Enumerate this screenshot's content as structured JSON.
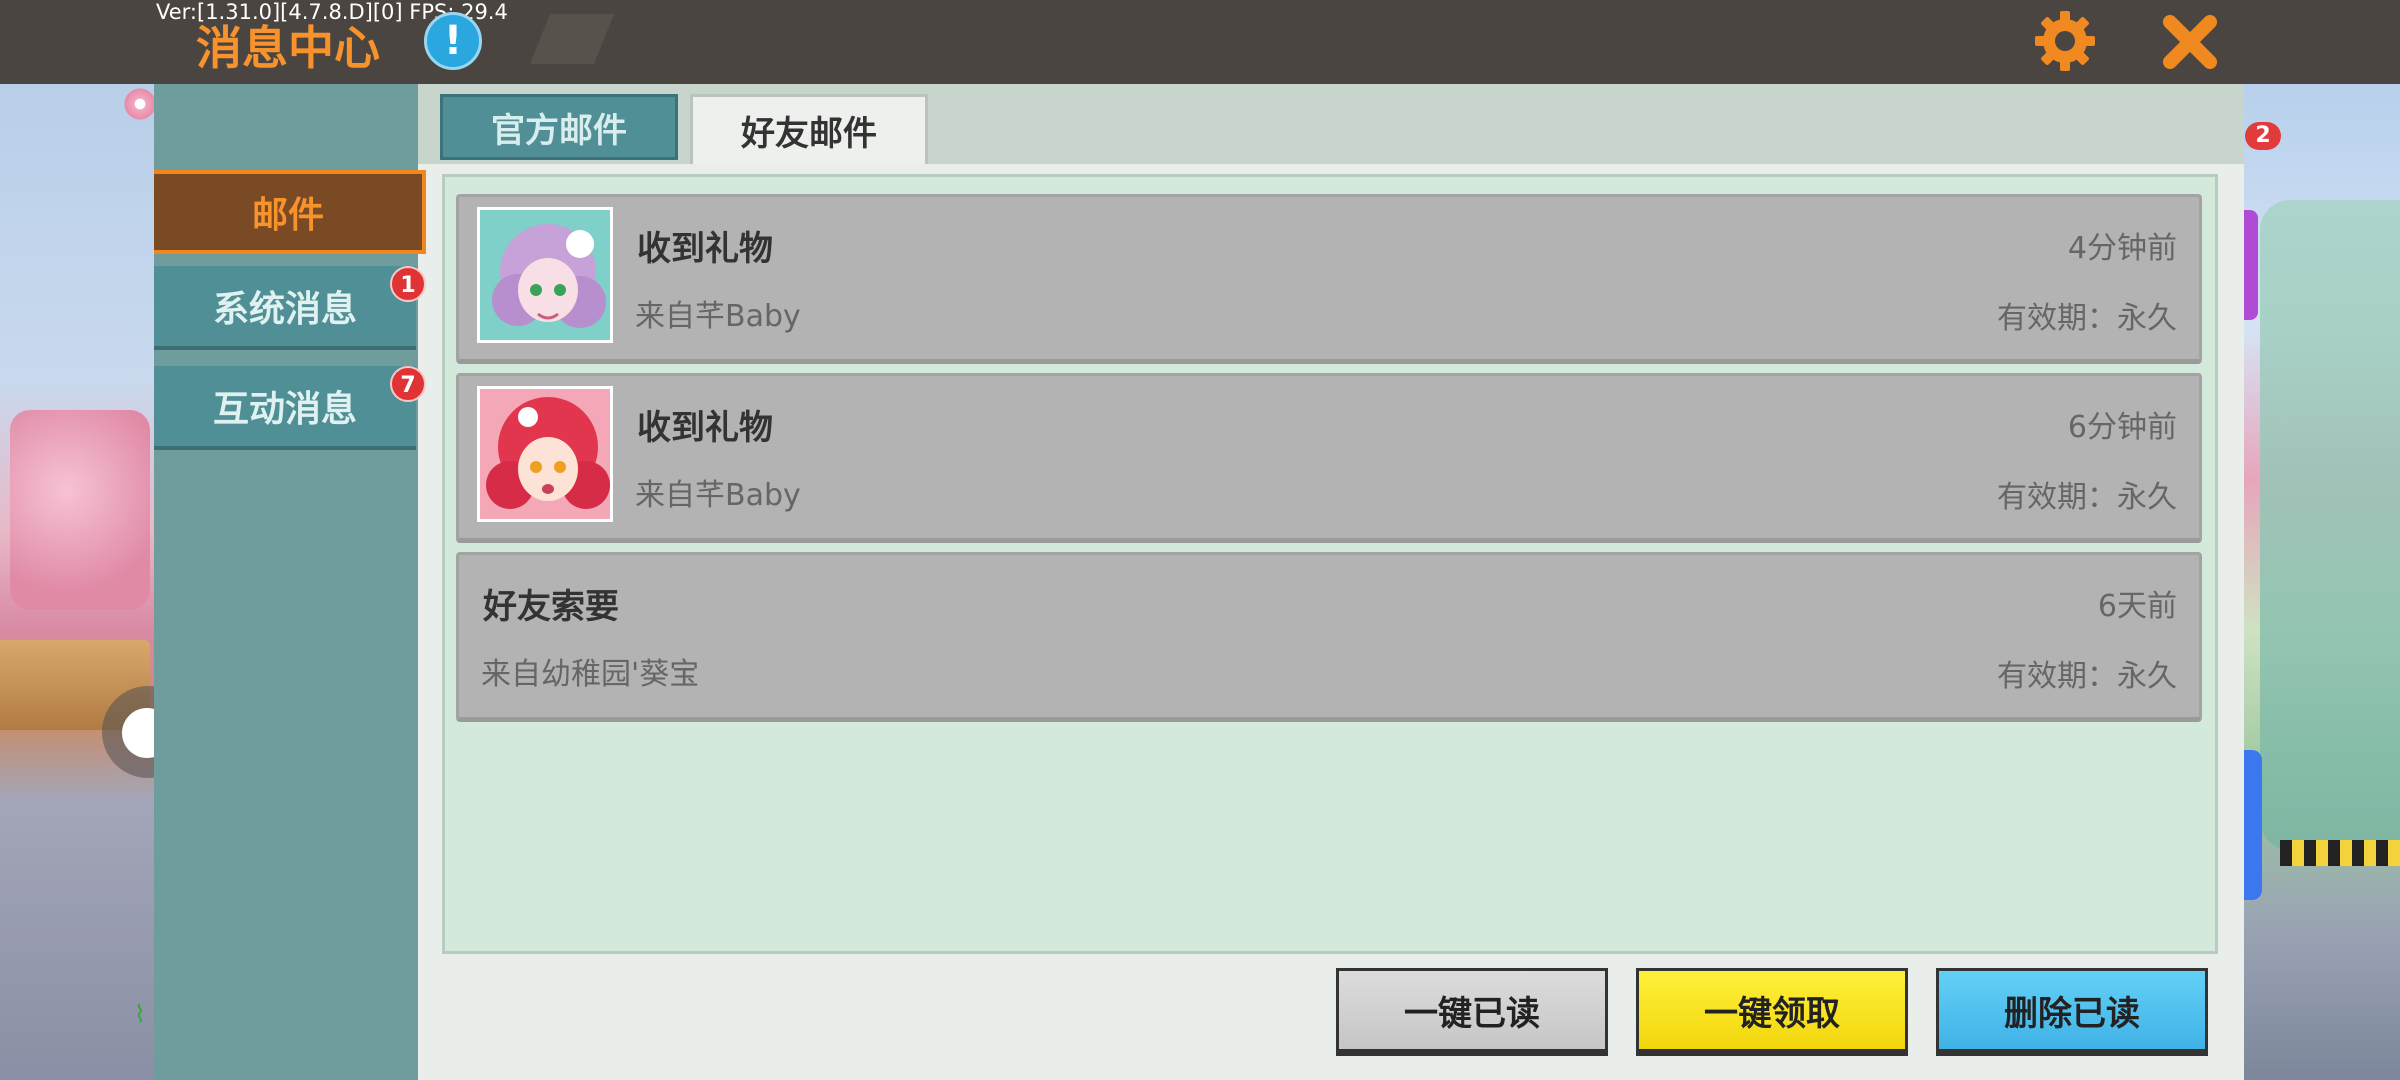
{
  "topbar": {
    "debug_text": "Ver:[1.31.0][4.7.8.D][0] FPS: 29.4",
    "title": "消息中心",
    "info_glyph": "!",
    "settings_icon": "gear-icon",
    "close_icon": "close-x-icon",
    "accent_color": "#f7922d"
  },
  "sidebar": {
    "items": [
      {
        "label": "邮件",
        "active": true
      },
      {
        "label": "系统消息",
        "badge": "1"
      },
      {
        "label": "互动消息",
        "badge": "7"
      }
    ]
  },
  "tabs": [
    {
      "label": "官方邮件",
      "active": false
    },
    {
      "label": "好友邮件",
      "active": true
    }
  ],
  "mails": [
    {
      "title": "收到礼物",
      "from": "来自芊Baby",
      "time": "4分钟前",
      "validity": "有效期：永久",
      "avatar": "avatar-purple-hair"
    },
    {
      "title": "收到礼物",
      "from": "来自芊Baby",
      "time": "6分钟前",
      "validity": "有效期：永久",
      "avatar": "avatar-red-hair"
    },
    {
      "title": "好友索要",
      "from": "来自幼稚园'葵宝",
      "time": "6天前",
      "validity": "有效期：永久"
    }
  ],
  "actions": {
    "mark_all_read": "一键已读",
    "claim_all": "一键领取",
    "delete_read": "删除已读"
  },
  "background": {
    "notification_badge": "2"
  }
}
